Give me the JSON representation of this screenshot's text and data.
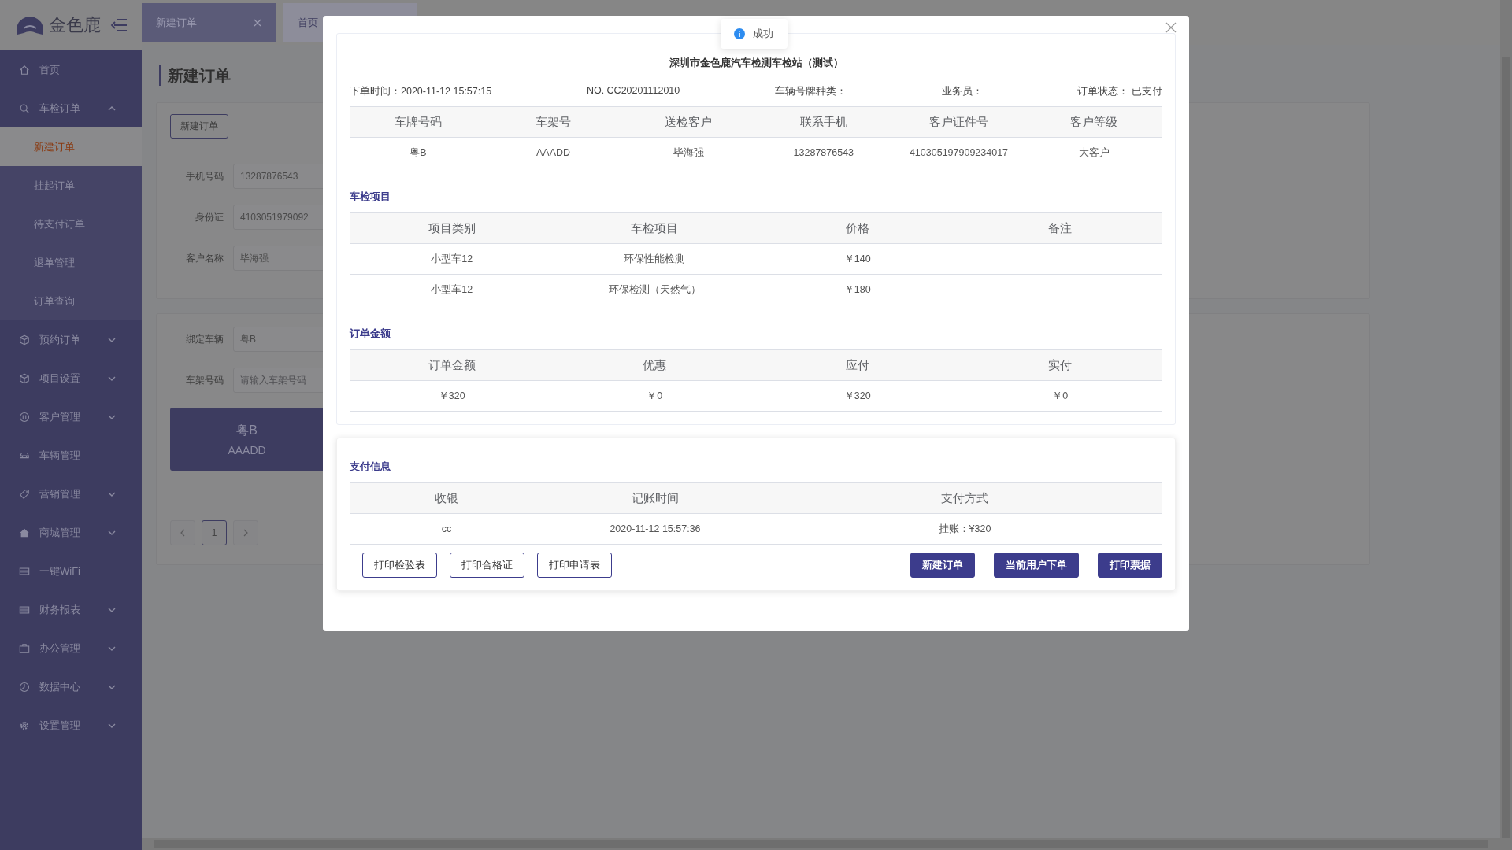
{
  "logo": {
    "text": "金色鹿"
  },
  "sidebar": {
    "items": [
      {
        "label": "首页",
        "kind": "link"
      },
      {
        "label": "车检订单",
        "kind": "menu",
        "expanded": true,
        "children": [
          {
            "label": "新建订单",
            "selected": true
          },
          {
            "label": "挂起订单",
            "selected": false
          },
          {
            "label": "待支付订单",
            "selected": false
          },
          {
            "label": "退单管理",
            "selected": false
          },
          {
            "label": "订单查询",
            "selected": false
          }
        ]
      },
      {
        "label": "预约订单",
        "kind": "menu",
        "expanded": false
      },
      {
        "label": "项目设置",
        "kind": "menu",
        "expanded": false
      },
      {
        "label": "客户管理",
        "kind": "menu",
        "expanded": false
      },
      {
        "label": "车辆管理",
        "kind": "link"
      },
      {
        "label": "营销管理",
        "kind": "menu",
        "expanded": false
      },
      {
        "label": "商城管理",
        "kind": "menu",
        "expanded": false
      },
      {
        "label": "一键WiFi",
        "kind": "link"
      },
      {
        "label": "财务报表",
        "kind": "menu",
        "expanded": false
      },
      {
        "label": "办公管理",
        "kind": "menu",
        "expanded": false
      },
      {
        "label": "数据中心",
        "kind": "menu",
        "expanded": false
      },
      {
        "label": "设置管理",
        "kind": "menu",
        "expanded": false
      }
    ]
  },
  "tabs": [
    {
      "label": "新建订单",
      "selected": true,
      "closable": true
    },
    {
      "label": "首页",
      "selected": false
    }
  ],
  "page": {
    "title": "新建订单",
    "new_button": "新建订单",
    "customer_fields": [
      {
        "label": "手机号码",
        "value": "13287876543"
      },
      {
        "label": "身份证",
        "value": "4103051979092"
      },
      {
        "label": "客户名称",
        "value": "毕海强"
      }
    ],
    "vehicle_fields": [
      {
        "label": "绑定车辆",
        "value": "粤B"
      },
      {
        "label": "车架号码",
        "placeholder": "请输入车架号码"
      }
    ],
    "vehicle_card": {
      "plate": "粤B",
      "frame": "AAADD",
      "selected": true
    },
    "pagination": {
      "pages": [
        {
          "label": "1",
          "selected": true
        }
      ]
    }
  },
  "toast": {
    "text": "成功"
  },
  "dialog": {
    "title": "深圳市金色鹿汽车检测车检站（测试）",
    "meta": [
      "下单时间：2020-11-12 15:57:15",
      "NO. CC20201112010",
      "车辆号牌种类：",
      "业务员：",
      "订单状态： 已支付"
    ],
    "customer_table": {
      "columns": [
        "车牌号码",
        "车架号",
        "送检客户",
        "联系手机",
        "客户证件号",
        "客户等级"
      ],
      "rows": [
        [
          "粤B",
          "AAADD",
          "毕海强",
          "13287876543",
          "410305197909234017",
          "大客户"
        ]
      ]
    },
    "items_section": {
      "title": "车检项目",
      "columns": [
        "项目类别",
        "车检项目",
        "价格",
        "备注"
      ],
      "rows": [
        [
          "小型车12",
          "环保性能检测",
          "￥140"
        ],
        [
          "小型车12",
          "环保检测（天然气）",
          "￥180"
        ]
      ]
    },
    "amount_section": {
      "title": "订单金额",
      "columns": [
        "订单金额",
        "优惠",
        "应付",
        "实付"
      ],
      "rows": [
        [
          "￥320",
          "￥0",
          "￥320",
          "￥0"
        ]
      ]
    },
    "payment_section": {
      "title": "支付信息",
      "columns": [
        "收银",
        "记账时间",
        "支付方式"
      ],
      "rows": [
        [
          "cc",
          "2020-11-12 15:57:36",
          "挂账：¥320"
        ]
      ]
    },
    "buttons": [
      {
        "label": "打印检验表",
        "kind": "outline"
      },
      {
        "label": "打印合格证",
        "kind": "outline"
      },
      {
        "label": "打印申请表",
        "kind": "outline"
      },
      {
        "label": "新建订单",
        "kind": "primary"
      },
      {
        "label": "当前用户下单",
        "kind": "primary"
      },
      {
        "label": "打印票据",
        "kind": "primary"
      }
    ]
  }
}
